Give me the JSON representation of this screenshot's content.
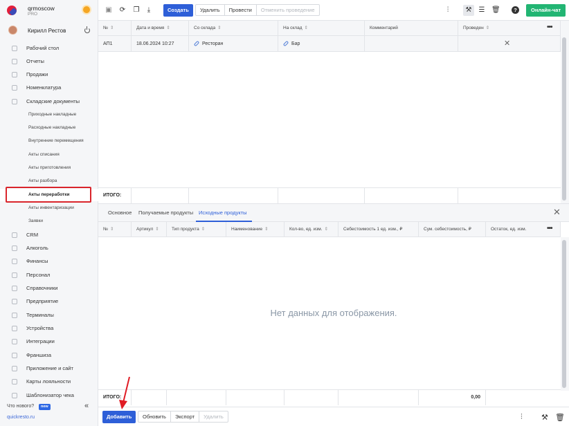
{
  "brand": {
    "name": "qrmoscow",
    "plan": "PRO"
  },
  "user": {
    "name": "Кирилл Рестов"
  },
  "nav": [
    {
      "label": "Рабочий стол"
    },
    {
      "label": "Отчеты"
    },
    {
      "label": "Продажи"
    },
    {
      "label": "Номенклатура"
    },
    {
      "label": "Складские документы"
    }
  ],
  "subnav": [
    {
      "label": "Приходные накладные"
    },
    {
      "label": "Расходные накладные"
    },
    {
      "label": "Внутренние перемещения"
    },
    {
      "label": "Акты списания"
    },
    {
      "label": "Акты приготовления"
    },
    {
      "label": "Акты разбора"
    },
    {
      "label": "Акты переработки"
    },
    {
      "label": "Акты инвентаризации"
    },
    {
      "label": "Заявки"
    }
  ],
  "nav2": [
    {
      "label": "CRM"
    },
    {
      "label": "Алкоголь"
    },
    {
      "label": "Финансы"
    },
    {
      "label": "Персонал"
    },
    {
      "label": "Справочники"
    },
    {
      "label": "Предприятие"
    },
    {
      "label": "Терминалы"
    },
    {
      "label": "Устройства"
    },
    {
      "label": "Интеграции"
    },
    {
      "label": "Франшиза"
    },
    {
      "label": "Приложение и сайт"
    },
    {
      "label": "Карты лояльности"
    },
    {
      "label": "Шаблонизатор чека"
    }
  ],
  "footer": {
    "whats_new": "Что нового?",
    "new_badge": "new",
    "site": "quickresto.ru"
  },
  "toolbar": {
    "create": "Создать",
    "delete": "Удалить",
    "post": "Провести",
    "unpost": "Отменить проведение",
    "chat": "Онлайн-чат"
  },
  "docs_table": {
    "headers": [
      "№",
      "Дата и время",
      "Со склада",
      "На склад",
      "Комментарий",
      "Проведен"
    ],
    "rows": [
      {
        "num": "АП1",
        "date": "18.06.2024 10:27",
        "from": "Ресторан",
        "to": "Бар",
        "comment": ""
      }
    ],
    "total_label": "ИТОГО:"
  },
  "tabs": [
    "Основное",
    "Получаемые продукты",
    "Исходные продукты"
  ],
  "products_table": {
    "headers": [
      "№",
      "Артикул",
      "Тип продукта",
      "Наименование",
      "Кол-во, ед. изм.",
      "Себестоимость 1 ед. изм., ₽",
      "Сум. себестоимость, ₽",
      "Остаток, ед. изм."
    ],
    "empty": "Нет данных для отображения.",
    "total_label": "ИТОГО:",
    "total_sum": "0,00"
  },
  "bottombar": {
    "add": "Добавить",
    "refresh": "Обновить",
    "export": "Экспорт",
    "delete": "Удалить"
  },
  "colors": {
    "accent": "#2e5fd8",
    "green": "#22b573",
    "highlight": "#d9242b"
  }
}
